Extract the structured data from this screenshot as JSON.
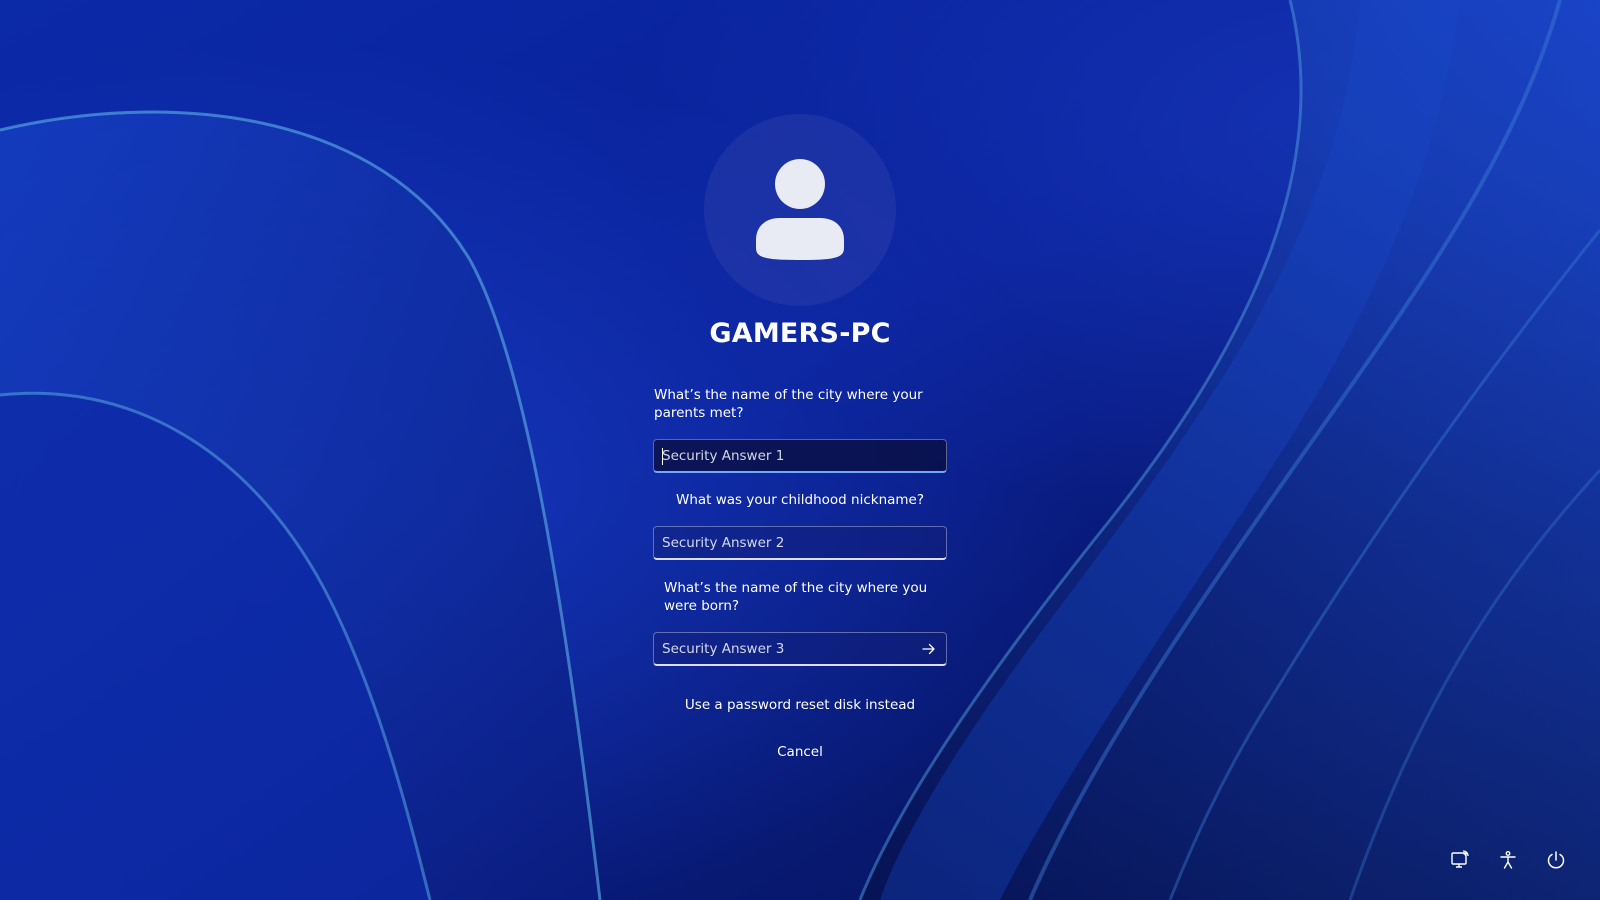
{
  "user": {
    "name": "GAMERS-PC",
    "avatar_icon": "user-silhouette-icon"
  },
  "security": {
    "question_1": "What’s the name of the city where your parents met?",
    "answer_1_placeholder": "Security Answer 1",
    "question_2": "What was your childhood nickname?",
    "answer_2_placeholder": "Security Answer 2",
    "question_3": "What’s the name of the city where you were born?",
    "answer_3_placeholder": "Security Answer 3",
    "submit_icon": "arrow-right-icon"
  },
  "links": {
    "reset_disk": "Use a password reset disk instead",
    "cancel": "Cancel"
  },
  "tray": {
    "network_icon": "network-icon",
    "accessibility_icon": "accessibility-icon",
    "power_icon": "power-icon"
  },
  "colors": {
    "background": "#0a1a8a",
    "accent": "#6fa8ff"
  }
}
